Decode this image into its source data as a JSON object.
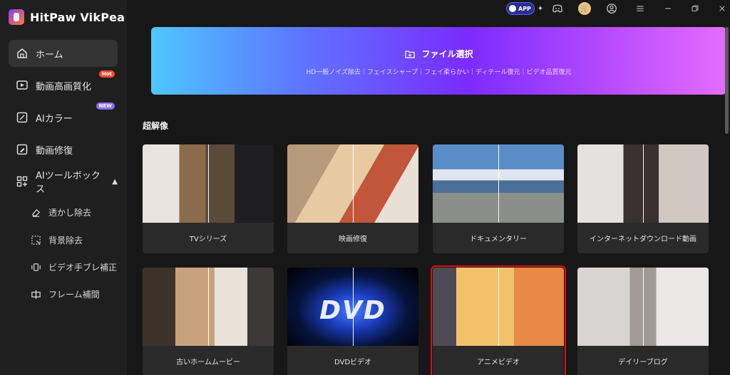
{
  "app": {
    "title": "HitPaw VikPea"
  },
  "sidebar": {
    "items": [
      {
        "label": "ホーム",
        "icon": "home-icon",
        "active": true
      },
      {
        "label": "動画高画質化",
        "icon": "uhd-video-icon",
        "badge": "Hot"
      },
      {
        "label": "AIカラー",
        "icon": "ai-color-icon",
        "badge": "NEW"
      },
      {
        "label": "動画修復",
        "icon": "repair-icon"
      },
      {
        "label": "AIツールボックス",
        "icon": "toolbox-icon",
        "expanded": true
      }
    ],
    "subitems": [
      {
        "label": "透かし除去",
        "icon": "eraser-icon"
      },
      {
        "label": "背景除去",
        "icon": "background-remove-icon"
      },
      {
        "label": "ビデオ手ブレ補正",
        "icon": "stabilize-icon"
      },
      {
        "label": "フレーム補間",
        "icon": "frame-interpolation-icon"
      }
    ]
  },
  "topbar": {
    "app_label": "APP"
  },
  "banner": {
    "title": "ファイル選択",
    "subtitle": "HD一般ノイズ除去｜フェイスシャープ｜フェイ柔らかい｜ディテール復元｜ビデオ品質復元"
  },
  "section": {
    "title": "超解像"
  },
  "cards": [
    {
      "label": "TVシリーズ"
    },
    {
      "label": "映画修復"
    },
    {
      "label": "ドキュメンタリー"
    },
    {
      "label": "インターネットダウンロード動画"
    },
    {
      "label": "古いホームムービー"
    },
    {
      "label": "DVDビデオ",
      "art_text": "DVD"
    },
    {
      "label": "アニメビデオ",
      "selected": true
    },
    {
      "label": "デイリーブログ"
    }
  ],
  "colors": {
    "selected_outline": "#e10d0d",
    "accent": "#7b2bff"
  }
}
